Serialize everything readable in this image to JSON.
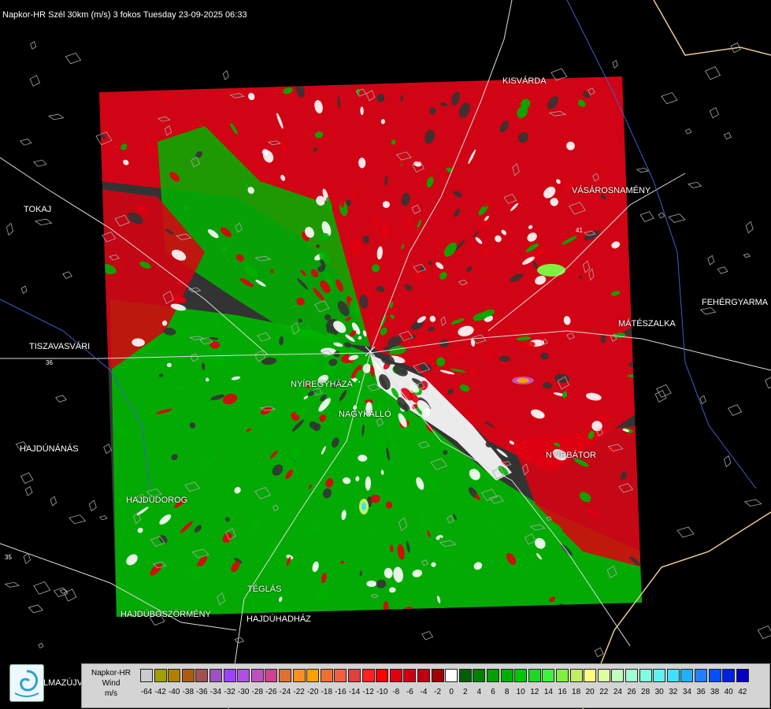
{
  "header": {
    "title": "Napkor-HR Szél 30km (m/s) 3 fokos Tuesday 23-09-2025 06:33"
  },
  "cities": [
    {
      "id": "kisvarda",
      "label": "KISVÁRDA"
    },
    {
      "id": "tokaj",
      "label": "TOKAJ"
    },
    {
      "id": "vasarosnameny",
      "label": "VÁSÁROSNAMÉNY"
    },
    {
      "id": "fehergyarmat",
      "label": "FEHÉRGYARMA"
    },
    {
      "id": "tiszavasvari",
      "label": "TISZAVASVÁRI"
    },
    {
      "id": "mateszalka",
      "label": "MÁTÉSZALKA"
    },
    {
      "id": "nyiregyhaza",
      "label": "NYÍREGYHÁZA"
    },
    {
      "id": "nagykallo",
      "label": "NAGYKÁLLÓ"
    },
    {
      "id": "hajdunanas",
      "label": "HAJDÚNÁNÁS"
    },
    {
      "id": "nyirbator",
      "label": "NYÍRBÁTOR"
    },
    {
      "id": "hajdudorog",
      "label": "HAJDÚDOROG"
    },
    {
      "id": "teglas",
      "label": "TÉGLÁS"
    },
    {
      "id": "hajduboszormeny",
      "label": "HAJDÚBÖSZÖRMÉNY"
    },
    {
      "id": "hajduhadhaz",
      "label": "HAJDÚHADHÁZ"
    },
    {
      "id": "balmazujvaros",
      "label": "LMAZÚJVÁR"
    }
  ],
  "roads": [
    {
      "id": "r36",
      "label": "36"
    },
    {
      "id": "r35",
      "label": "35"
    },
    {
      "id": "r41",
      "label": "41"
    }
  ],
  "legend": {
    "line1": "Napkor-HR",
    "line2": "Wind",
    "line3": "m/s",
    "bins": [
      {
        "v": "-64",
        "c": "#cccccc"
      },
      {
        "v": "-42",
        "c": "#a0a000"
      },
      {
        "v": "-40",
        "c": "#b08000"
      },
      {
        "v": "-38",
        "c": "#b05a10"
      },
      {
        "v": "-36",
        "c": "#a05050"
      },
      {
        "v": "-34",
        "c": "#a050c0"
      },
      {
        "v": "-32",
        "c": "#a040ff"
      },
      {
        "v": "-30",
        "c": "#b050e0"
      },
      {
        "v": "-28",
        "c": "#c050c0"
      },
      {
        "v": "-26",
        "c": "#d04090"
      },
      {
        "v": "-24",
        "c": "#e07030"
      },
      {
        "v": "-22",
        "c": "#ff9020"
      },
      {
        "v": "-20",
        "c": "#ffa000"
      },
      {
        "v": "-18",
        "c": "#f07030"
      },
      {
        "v": "-16",
        "c": "#f06040"
      },
      {
        "v": "-14",
        "c": "#e04040"
      },
      {
        "v": "-12",
        "c": "#ff2020"
      },
      {
        "v": "-10",
        "c": "#ff0000"
      },
      {
        "v": "-8",
        "c": "#e00010"
      },
      {
        "v": "-6",
        "c": "#d00010"
      },
      {
        "v": "-4",
        "c": "#c00010"
      },
      {
        "v": "-2",
        "c": "#a00000"
      },
      {
        "v": "0",
        "c": "#ffffff"
      },
      {
        "v": "2",
        "c": "#006000"
      },
      {
        "v": "4",
        "c": "#008000"
      },
      {
        "v": "6",
        "c": "#00a000"
      },
      {
        "v": "8",
        "c": "#00b000"
      },
      {
        "v": "10",
        "c": "#00c800"
      },
      {
        "v": "12",
        "c": "#20d820"
      },
      {
        "v": "14",
        "c": "#40f040"
      },
      {
        "v": "16",
        "c": "#80f040"
      },
      {
        "v": "18",
        "c": "#c0f060"
      },
      {
        "v": "20",
        "c": "#ffff80"
      },
      {
        "v": "22",
        "c": "#e0ffa0"
      },
      {
        "v": "24",
        "c": "#c0ffc0"
      },
      {
        "v": "26",
        "c": "#a0ffd0"
      },
      {
        "v": "28",
        "c": "#80ffe0"
      },
      {
        "v": "30",
        "c": "#60f0f0"
      },
      {
        "v": "32",
        "c": "#40e0ff"
      },
      {
        "v": "34",
        "c": "#20b0ff"
      },
      {
        "v": "36",
        "c": "#2080ff"
      },
      {
        "v": "38",
        "c": "#0050ff"
      },
      {
        "v": "40",
        "c": "#0020e0"
      },
      {
        "v": "42",
        "c": "#0000c0"
      }
    ]
  },
  "colors": {
    "positive": "#00b000",
    "negative": "#e00010",
    "zero": "#ffffff",
    "nodata": "#333333"
  }
}
